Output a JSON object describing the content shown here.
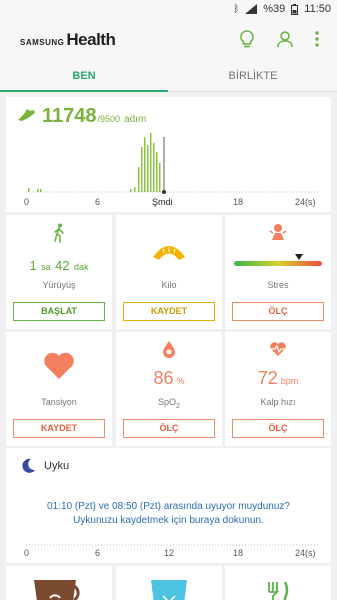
{
  "status": {
    "battery": "%39",
    "time": "11:50"
  },
  "brand": {
    "samsung": "SAMSUNG",
    "health": "Health"
  },
  "tabs": {
    "ben": "BEN",
    "birlikte": "BİRLİKTE"
  },
  "steps": {
    "value": "11748",
    "goal": "/9500",
    "unit": "adım",
    "ticks": [
      "0",
      "6",
      "Şmdi",
      "18",
      "24(s)"
    ]
  },
  "walking": {
    "hours": "1",
    "h_unit": "sa",
    "minutes": "42",
    "m_unit": "dak",
    "name": "Yürüyüş",
    "button": "BAŞLAT"
  },
  "weight": {
    "name": "Kilo",
    "button": "KAYDET"
  },
  "stress": {
    "name": "Stres",
    "button": "ÖLÇ"
  },
  "bp": {
    "name": "Tansiyon",
    "button": "KAYDET"
  },
  "spo2": {
    "value": "86",
    "unit": "%",
    "name": "SpO",
    "sub": "2",
    "button": "ÖLÇ"
  },
  "heart": {
    "value": "72",
    "unit": "bpm",
    "name": "Kalp hızı",
    "button": "ÖLÇ"
  },
  "sleep": {
    "title": "Uyku",
    "line1": "01:10 (Pzt) ve 08:50 (Pzt) arasında uyuyor muydunuz?",
    "line2": "Uykunuzu kaydetmek için buraya dokunun.",
    "ticks": [
      "0",
      "6",
      "12",
      "18",
      "24(s)"
    ]
  },
  "colors": {
    "accent": "#2aa86e",
    "steps": "#7ab33c",
    "orange": "#f4805f",
    "yellow": "#f5b400"
  }
}
